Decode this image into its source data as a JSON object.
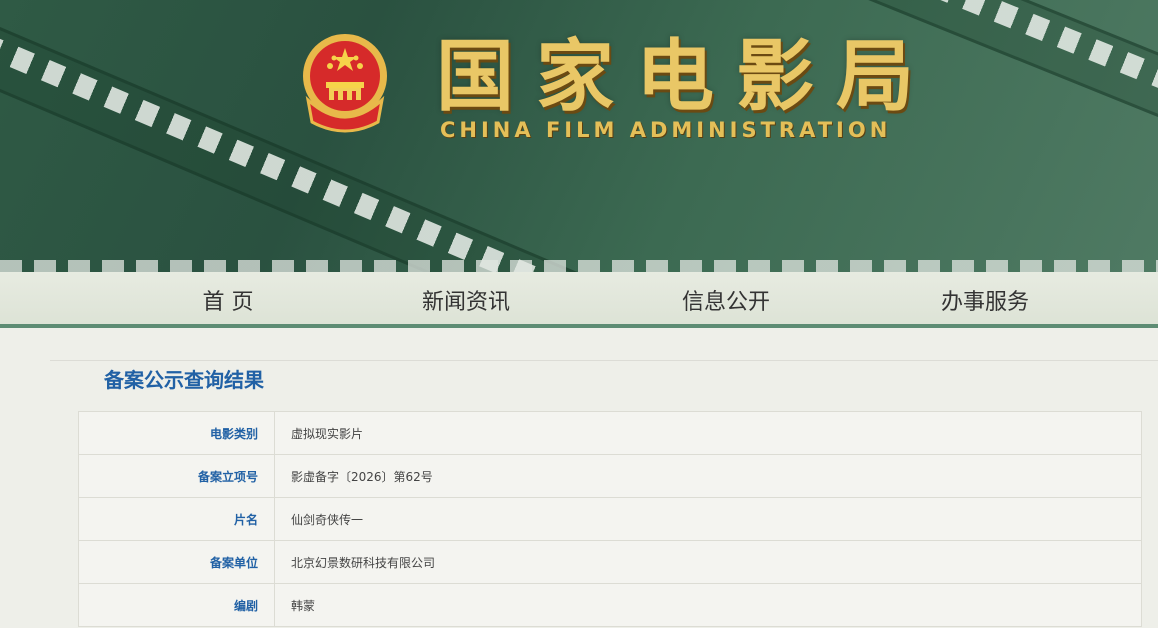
{
  "header": {
    "title_cn_chars": [
      "国",
      "家",
      "电",
      "影",
      "局"
    ],
    "title_en": "CHINA FILM ADMINISTRATION",
    "emblem_icon": "national-emblem-icon"
  },
  "nav": {
    "items": [
      {
        "label": "首 页"
      },
      {
        "label": "新闻资讯"
      },
      {
        "label": "信息公开"
      },
      {
        "label": "办事服务"
      }
    ]
  },
  "main": {
    "section_title": "备案公示查询结果",
    "rows": [
      {
        "key": "电影类别",
        "value": "虚拟现实影片"
      },
      {
        "key": "备案立项号",
        "value": "影虚备字〔2026〕第62号"
      },
      {
        "key": "片名",
        "value": "仙剑奇侠传一"
      },
      {
        "key": "备案单位",
        "value": "北京幻景数研科技有限公司"
      },
      {
        "key": "编剧",
        "value": "韩蒙"
      }
    ]
  },
  "colors": {
    "banner_green": "#2f5a45",
    "title_gold": "#e9c766",
    "link_blue": "#2161a5",
    "nav_border": "#5d8c73"
  }
}
